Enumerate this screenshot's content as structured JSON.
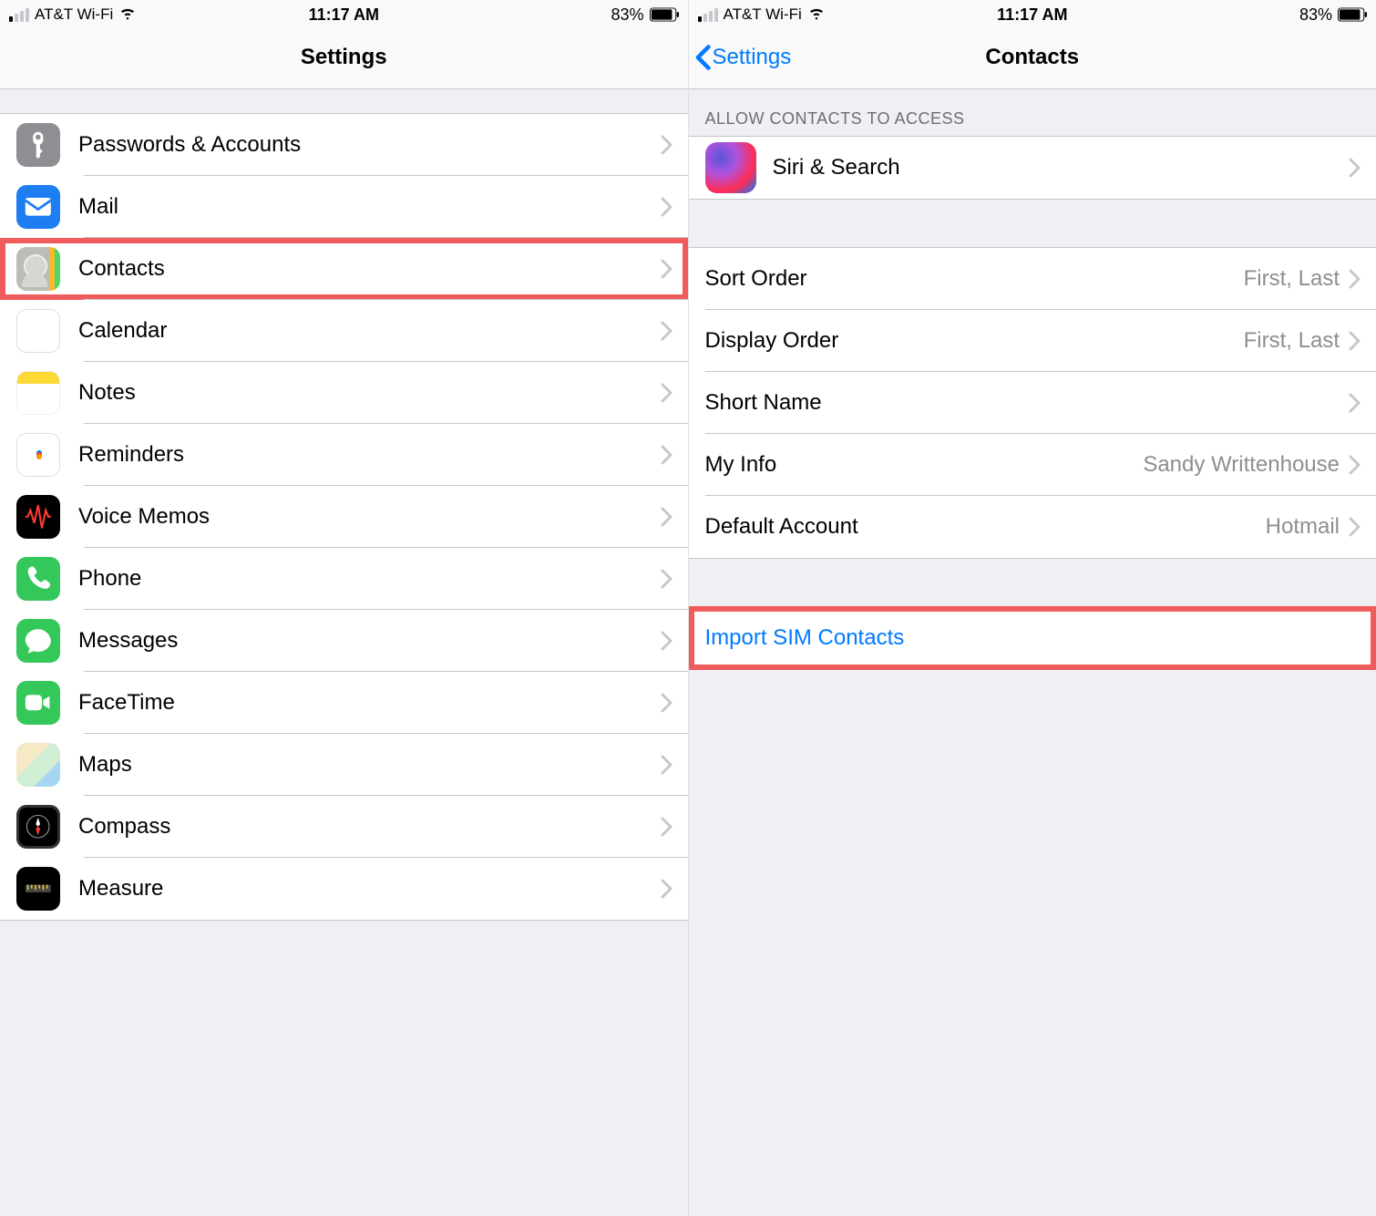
{
  "status": {
    "carrier": "AT&T Wi-Fi",
    "time": "11:17 AM",
    "battery": "83%"
  },
  "left": {
    "title": "Settings",
    "items": [
      {
        "label": "Passwords & Accounts",
        "icon": "passwords-icon"
      },
      {
        "label": "Mail",
        "icon": "mail-icon"
      },
      {
        "label": "Contacts",
        "icon": "contacts-icon",
        "highlight": true
      },
      {
        "label": "Calendar",
        "icon": "calendar-icon"
      },
      {
        "label": "Notes",
        "icon": "notes-icon"
      },
      {
        "label": "Reminders",
        "icon": "reminders-icon"
      },
      {
        "label": "Voice Memos",
        "icon": "voice-memos-icon"
      },
      {
        "label": "Phone",
        "icon": "phone-icon"
      },
      {
        "label": "Messages",
        "icon": "messages-icon"
      },
      {
        "label": "FaceTime",
        "icon": "facetime-icon"
      },
      {
        "label": "Maps",
        "icon": "maps-icon"
      },
      {
        "label": "Compass",
        "icon": "compass-icon"
      },
      {
        "label": "Measure",
        "icon": "measure-icon"
      }
    ]
  },
  "right": {
    "back": "Settings",
    "title": "Contacts",
    "sectionHeader": "Allow Contacts to Access",
    "siri": {
      "label": "Siri & Search"
    },
    "rows": [
      {
        "label": "Sort Order",
        "value": "First, Last"
      },
      {
        "label": "Display Order",
        "value": "First, Last"
      },
      {
        "label": "Short Name",
        "value": ""
      },
      {
        "label": "My Info",
        "value": "Sandy Writtenhouse"
      },
      {
        "label": "Default Account",
        "value": "Hotmail"
      }
    ],
    "import": {
      "label": "Import SIM Contacts",
      "highlight": true
    }
  }
}
